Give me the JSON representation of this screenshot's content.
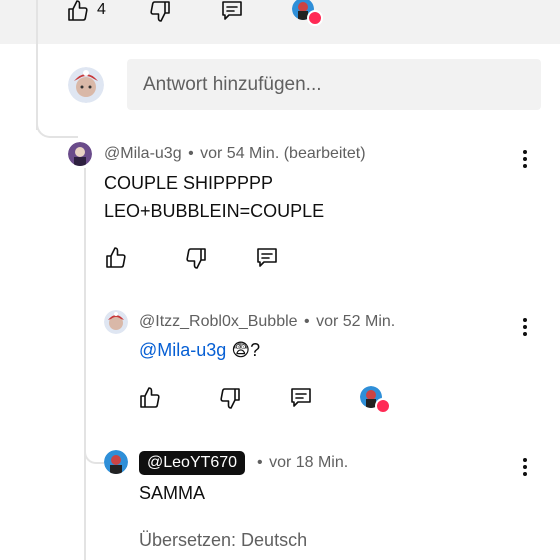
{
  "top_actions": {
    "like_count": "4"
  },
  "reply_box": {
    "placeholder": "Antwort hinzufügen..."
  },
  "comments": [
    {
      "author": "@Mila-u3g",
      "time": "vor 54 Min.",
      "edited": "(bearbeitet)",
      "lines": [
        "COUPLE SHIPPPPP",
        "LEO+BUBBLEIN=COUPLE"
      ]
    },
    {
      "author": "@Itzz_Robl0x_Bubble",
      "time": "vor 52 Min.",
      "mention": "@Mila-u3g",
      "emoji": "😨",
      "suffix": "?"
    },
    {
      "author": "@LeoYT670",
      "time": "vor 18 Min.",
      "text": "SAMMA",
      "translate": "Übersetzen: Deutsch"
    }
  ],
  "separator": "•",
  "colors": {
    "link": "#065fd4",
    "heart": "#ff2a55",
    "muted": "#606060"
  }
}
